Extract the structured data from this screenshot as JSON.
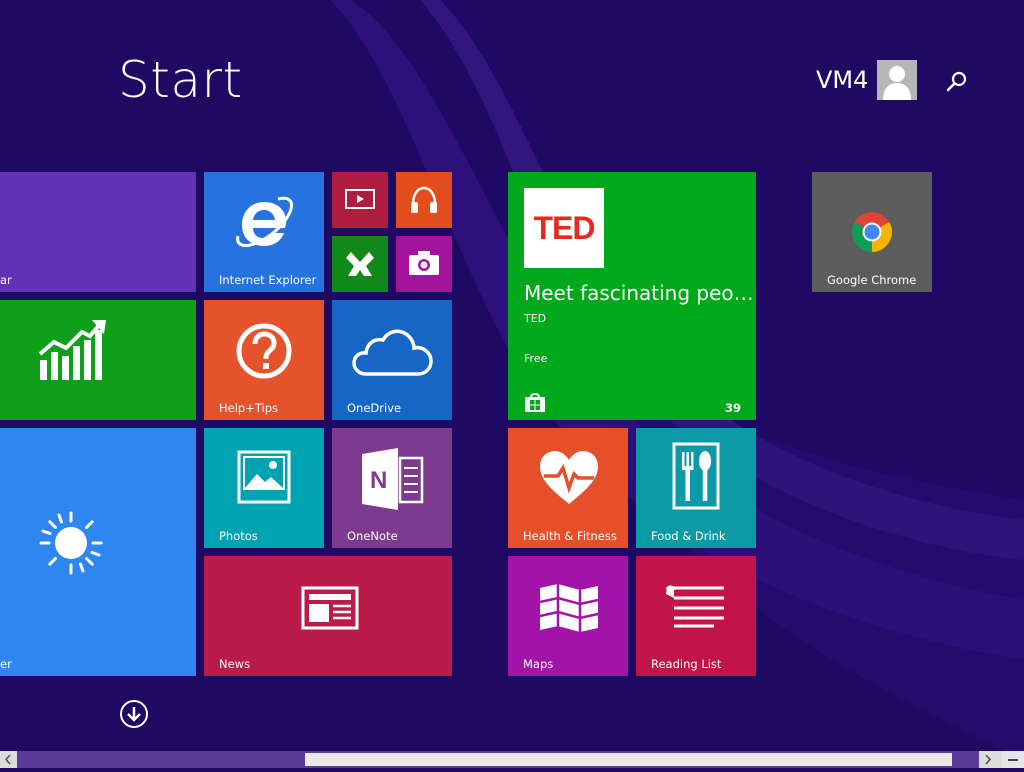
{
  "header": {
    "title": "Start",
    "user_name": "VM4"
  },
  "tiles": {
    "calendar": {
      "label": "ar",
      "color": "#6133b4"
    },
    "internet_explorer": {
      "label": "Internet Explorer",
      "color": "#2673e0"
    },
    "video": {
      "color": "#ae1c3f"
    },
    "music": {
      "color": "#e14d1d"
    },
    "games": {
      "color": "#10891a"
    },
    "camera": {
      "color": "#a3139c"
    },
    "finance": {
      "color": "#109f1a"
    },
    "help_tips": {
      "label": "Help+Tips",
      "color": "#e5532c"
    },
    "onedrive": {
      "label": "OneDrive",
      "color": "#1566c5"
    },
    "weather": {
      "label": "er",
      "color": "#2f86f0"
    },
    "photos": {
      "label": "Photos",
      "color": "#01a2b1"
    },
    "onenote": {
      "label": "OneNote",
      "color": "#7e3a8e"
    },
    "news": {
      "label": "News",
      "color": "#bb1b48"
    },
    "store_ted": {
      "logo_text": "TED",
      "headline": "Meet fascinating peo…",
      "publisher": "TED",
      "price": "Free",
      "count": "39",
      "color": "#00a81c"
    },
    "health_fitness": {
      "label": "Health & Fitness",
      "color": "#e5502b"
    },
    "food_drink": {
      "label": "Food & Drink",
      "color": "#0b9aa6"
    },
    "maps": {
      "label": "Maps",
      "color": "#a213a8"
    },
    "reading_list": {
      "label": "Reading List",
      "color": "#c2134a"
    },
    "google_chrome": {
      "label": "Google Chrome",
      "color": "#5c5c5c"
    }
  }
}
